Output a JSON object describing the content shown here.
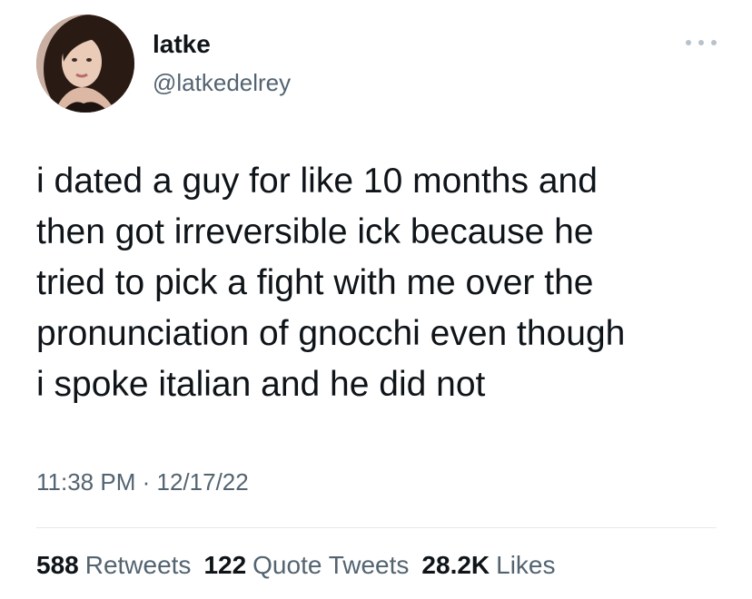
{
  "tweet": {
    "author": {
      "display_name": "latke",
      "handle": "@latkedelrey"
    },
    "text": "i dated a guy for like 10 months and\nthen got irreversible ick because he\ntried to pick a fight with me over the\npronunciation of gnocchi even though\ni spoke italian and he did not",
    "time": "11:38 PM",
    "separator": "·",
    "date": "12/17/22",
    "stats": [
      {
        "count": "588",
        "label": "Retweets"
      },
      {
        "count": "122",
        "label": "Quote Tweets"
      },
      {
        "count": "28.2K",
        "label": "Likes"
      }
    ]
  },
  "icons": {
    "more": "more-horizontal-icon",
    "avatar": "avatar"
  },
  "colors": {
    "text_primary": "#0f1419",
    "text_secondary": "#536471",
    "divider": "#e3e8ec",
    "more_dots": "#b9c2ca"
  }
}
